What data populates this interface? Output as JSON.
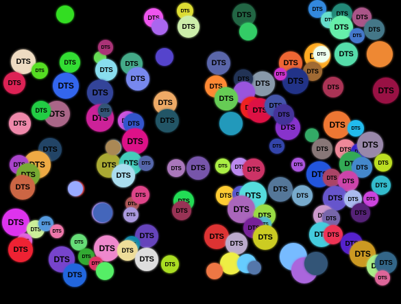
{
  "scene": {
    "background": "#000000",
    "label": "DTS",
    "bubbles": [
      {
        "color": "#33dd22",
        "labeled": false
      },
      {
        "color": "#ee55ee",
        "labeled": true
      },
      {
        "color": "#dddd33",
        "labeled": true
      },
      {
        "color": "#aa66ee",
        "labeled": false
      },
      {
        "color": "#cceeaa",
        "labeled": true
      },
      {
        "color": "#226644",
        "labeled": true
      },
      {
        "color": "#33cc66",
        "labeled": false
      },
      {
        "color": "#3388dd",
        "labeled": true
      },
      {
        "color": "#66ddcc",
        "labeled": true
      },
      {
        "color": "#228877",
        "labeled": true
      },
      {
        "color": "#66eeaa",
        "labeled": true
      },
      {
        "color": "#aa5588",
        "labeled": true
      },
      {
        "color": "#4477cc",
        "labeled": true
      },
      {
        "color": "#447788",
        "labeled": true
      },
      {
        "color": "#eedbc2",
        "labeled": true
      },
      {
        "color": "#dd2255",
        "labeled": true
      },
      {
        "color": "#55dd22",
        "labeled": true
      },
      {
        "color": "#33dd33",
        "labeled": true
      },
      {
        "color": "#3366ee",
        "labeled": true
      },
      {
        "color": "#66dd55",
        "labeled": false
      },
      {
        "color": "#aa3377",
        "labeled": true
      },
      {
        "color": "#88ddee",
        "labeled": true
      },
      {
        "color": "#44aa88",
        "labeled": true
      },
      {
        "color": "#7788ee",
        "labeled": true
      },
      {
        "color": "#5544cc",
        "labeled": false
      },
      {
        "color": "#5a66aa",
        "labeled": true
      },
      {
        "color": "#ff8833",
        "labeled": true
      },
      {
        "color": "#ee6633",
        "labeled": true
      },
      {
        "color": "#ffaa22",
        "labeled": true
      },
      {
        "color": "#eeffee",
        "labeled": true
      },
      {
        "color": "#a06a33",
        "labeled": true
      },
      {
        "color": "#223388",
        "labeled": true
      },
      {
        "color": "#cc33cc",
        "labeled": true
      },
      {
        "color": "#8899aa",
        "labeled": true
      },
      {
        "color": "#223355",
        "labeled": true
      },
      {
        "color": "#9955dd",
        "labeled": false
      },
      {
        "color": "#66cc55",
        "labeled": true
      },
      {
        "color": "#aa3355",
        "labeled": true
      },
      {
        "color": "#55ddaa",
        "labeled": true
      },
      {
        "color": "#ee8833",
        "labeled": false
      },
      {
        "color": "#991144",
        "labeled": true
      },
      {
        "color": "#aa6688",
        "labeled": true
      },
      {
        "color": "#22cc44",
        "labeled": true
      },
      {
        "color": "#334499",
        "labeled": true
      },
      {
        "color": "#cc2299",
        "labeled": true
      },
      {
        "color": "#335577",
        "labeled": true
      },
      {
        "color": "#eeaa66",
        "labeled": true
      },
      {
        "color": "#cc55dd",
        "labeled": true
      },
      {
        "color": "#225566",
        "labeled": true
      },
      {
        "color": "#3355cc",
        "labeled": true
      },
      {
        "color": "#ee2222",
        "labeled": true
      },
      {
        "color": "#dd1144",
        "labeled": true
      },
      {
        "color": "#4455aa",
        "labeled": true
      },
      {
        "color": "#8833cc",
        "labeled": true
      },
      {
        "color": "#443399",
        "labeled": true
      },
      {
        "color": "#2299bb",
        "labeled": false
      },
      {
        "color": "#ee88aa",
        "labeled": true
      },
      {
        "color": "#224466",
        "labeled": true
      },
      {
        "color": "#eeaa44",
        "labeled": true
      },
      {
        "color": "#aa44cc",
        "labeled": true
      },
      {
        "color": "#77aa33",
        "labeled": true
      },
      {
        "color": "#cc6644",
        "labeled": true
      },
      {
        "color": "#88bbee",
        "labeled": true
      },
      {
        "color": "#dd1188",
        "labeled": true
      },
      {
        "color": "#aaaa33",
        "labeled": true
      },
      {
        "color": "#44ccbb",
        "labeled": true
      },
      {
        "color": "#5566aa",
        "labeled": true
      },
      {
        "color": "#aaddee",
        "labeled": true
      },
      {
        "color": "#aa77bb",
        "labeled": true
      },
      {
        "color": "#7755aa",
        "labeled": true
      },
      {
        "color": "#aaee44",
        "labeled": true
      },
      {
        "color": "#bb88ee",
        "labeled": true
      },
      {
        "color": "#cc3366",
        "labeled": true
      },
      {
        "color": "#3344aa",
        "labeled": true
      },
      {
        "color": "#aa55dd",
        "labeled": true
      },
      {
        "color": "#33aa66",
        "labeled": false
      },
      {
        "color": "#ee7733",
        "labeled": true
      },
      {
        "color": "#22bbee",
        "labeled": true
      },
      {
        "color": "#887777",
        "labeled": true
      },
      {
        "color": "#ee8899",
        "labeled": true
      },
      {
        "color": "#3322cc",
        "labeled": true
      },
      {
        "color": "#9988aa",
        "labeled": true
      },
      {
        "color": "#bbdd22",
        "labeled": true
      },
      {
        "color": "#33aa55",
        "labeled": true
      },
      {
        "color": "#4488cc",
        "labeled": true
      },
      {
        "color": "#2255dd",
        "labeled": true
      },
      {
        "color": "#aa4466",
        "labeled": true
      },
      {
        "color": "#cc44aa",
        "labeled": true
      },
      {
        "color": "#33bbcc",
        "labeled": true
      },
      {
        "color": "#557799",
        "labeled": true
      },
      {
        "color": "#77aacc",
        "labeled": true
      },
      {
        "color": "#cc2211",
        "labeled": true
      },
      {
        "color": "#aa88dd",
        "labeled": true
      },
      {
        "color": "#aa5555",
        "labeled": true
      },
      {
        "color": "#aa99dd",
        "labeled": true
      },
      {
        "color": "#dd4488",
        "labeled": true
      },
      {
        "color": "#22dd55",
        "labeled": true
      },
      {
        "color": "#993355",
        "labeled": true
      },
      {
        "color": "#ffcc33",
        "labeled": true
      },
      {
        "color": "#5555cc",
        "labeled": true
      },
      {
        "color": "#55dddd",
        "labeled": true
      },
      {
        "color": "#6655cc",
        "labeled": true
      },
      {
        "color": "#aabbee",
        "labeled": true
      },
      {
        "color": "#cc44dd",
        "labeled": true
      },
      {
        "color": "#aa66bb",
        "labeled": true
      },
      {
        "color": "#99dd44",
        "labeled": true
      },
      {
        "color": "#55bbcc",
        "labeled": true
      },
      {
        "color": "#cc99cc",
        "labeled": true
      },
      {
        "color": "#7766aa",
        "labeled": true
      },
      {
        "color": "#552277",
        "labeled": true
      },
      {
        "color": "#dd33ee",
        "labeled": true
      },
      {
        "color": "#ccee99",
        "labeled": true
      },
      {
        "color": "#5599dd",
        "labeled": true
      },
      {
        "color": "#ee77aa",
        "labeled": true
      },
      {
        "color": "#dd66dd",
        "labeled": true
      },
      {
        "color": "#ee2233",
        "labeled": true
      },
      {
        "color": "#66dd77",
        "labeled": true
      },
      {
        "color": "#6644bb",
        "labeled": true
      },
      {
        "color": "#1188aa",
        "labeled": true
      },
      {
        "color": "#ee88cc",
        "labeled": true
      },
      {
        "color": "#eedd99",
        "labeled": true
      },
      {
        "color": "#dddddd",
        "labeled": true
      },
      {
        "color": "#aadd22",
        "labeled": true
      },
      {
        "color": "#dd3333",
        "labeled": true
      },
      {
        "color": "#bbaacc",
        "labeled": true
      },
      {
        "color": "#772299",
        "labeled": true
      },
      {
        "color": "#cccc22",
        "labeled": true
      },
      {
        "color": "#44ccdd",
        "labeled": true
      },
      {
        "color": "#ee3355",
        "labeled": true
      },
      {
        "color": "#5522cc",
        "labeled": true
      },
      {
        "color": "#cc9922",
        "labeled": true
      },
      {
        "color": "#aaee88",
        "labeled": true
      },
      {
        "color": "#336688",
        "labeled": true
      },
      {
        "color": "#dd6699",
        "labeled": true
      },
      {
        "color": "#7744cc",
        "labeled": true
      },
      {
        "color": "#2266dd",
        "labeled": true
      },
      {
        "color": "#33aa33",
        "labeled": true
      },
      {
        "color": "#dd3366",
        "labeled": true
      },
      {
        "color": "#55ee66",
        "labeled": false
      },
      {
        "color": "#eeee44",
        "labeled": false
      },
      {
        "color": "#66ccff",
        "labeled": false
      },
      {
        "color": "#5577aa",
        "labeled": false
      },
      {
        "color": "#ee7744",
        "labeled": false
      },
      {
        "color": "#77bbff",
        "labeled": false
      },
      {
        "color": "#aa66dd",
        "labeled": false
      },
      {
        "color": "#335577",
        "labeled": false
      },
      {
        "color": "#99aaff",
        "labeled": false
      },
      {
        "color": "#4466bb",
        "labeled": false
      },
      {
        "color": "#aa8855",
        "labeled": false
      }
    ]
  }
}
